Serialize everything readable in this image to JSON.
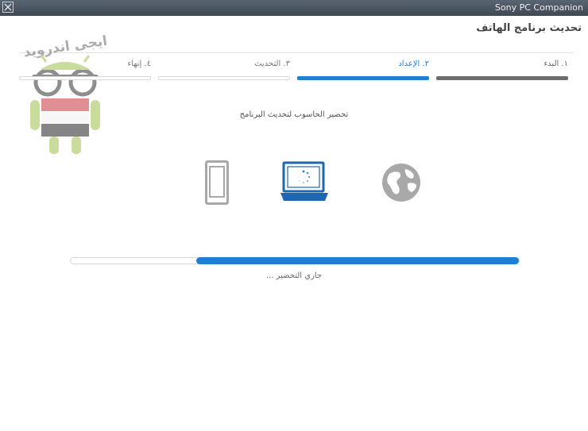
{
  "window": {
    "app_title": "Sony PC Companion"
  },
  "page": {
    "title": "تحديث برنامج الهاتف"
  },
  "steps": [
    {
      "label": "١. البدء",
      "state": "done"
    },
    {
      "label": "٢. الإعداد",
      "state": "active"
    },
    {
      "label": "٣. التحديث",
      "state": "pending"
    },
    {
      "label": "٤. إنهاء",
      "state": "pending"
    }
  ],
  "main": {
    "instruction": "تحضير الحاسوب لتحديث البرنامج",
    "status": "جاري التحضير ...",
    "progress_percent": 72
  },
  "watermark": {
    "text": "ايجى اندرويد"
  },
  "icons": {
    "phone": "phone-icon",
    "laptop": "laptop-icon",
    "globe": "globe-icon",
    "spinner": "loading-spinner-icon"
  },
  "colors": {
    "accent": "#1f7fd6",
    "done": "#6d6d6d",
    "titlebar": "#4a5460",
    "icon_gray": "#a8a8a8",
    "laptop_blue": "#1d66b0"
  }
}
